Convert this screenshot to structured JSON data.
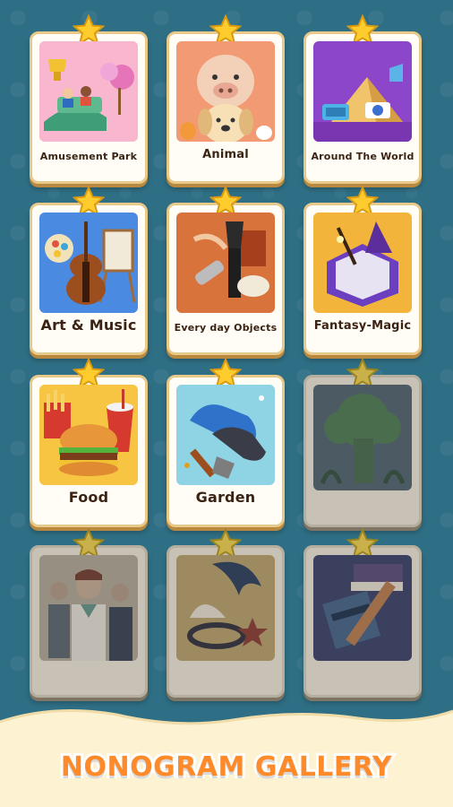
{
  "title": "NONOGRAM GALLERY",
  "colors": {
    "background": "#2f6f85",
    "card": "#fffdf6",
    "card_border": "#e9c98a",
    "locked_card": "#c7c2b5",
    "star": "#ffcc2e",
    "title": "#ff8a2a",
    "banner": "#fdf2d2"
  },
  "categories": [
    {
      "label": "Amusement Park",
      "locked": false,
      "icon": "roller-coaster-icon"
    },
    {
      "label": "Animal",
      "locked": false,
      "icon": "pig-dog-icon"
    },
    {
      "label": "Around The World",
      "locked": false,
      "icon": "pyramid-icon"
    },
    {
      "label": "Art & Music",
      "locked": false,
      "icon": "violin-icon"
    },
    {
      "label": "Every day Objects",
      "locked": false,
      "icon": "flashlight-icon"
    },
    {
      "label": "Fantasy-Magic",
      "locked": false,
      "icon": "magic-hat-icon"
    },
    {
      "label": "Food",
      "locked": false,
      "icon": "burger-icon"
    },
    {
      "label": "Garden",
      "locked": false,
      "icon": "glove-shovel-icon"
    },
    {
      "label": "",
      "locked": true,
      "icon": "tree-icon"
    },
    {
      "label": "",
      "locked": true,
      "icon": "people-icon"
    },
    {
      "label": "",
      "locked": true,
      "icon": "shell-wave-icon"
    },
    {
      "label": "",
      "locked": true,
      "icon": "book-pencil-icon"
    }
  ]
}
